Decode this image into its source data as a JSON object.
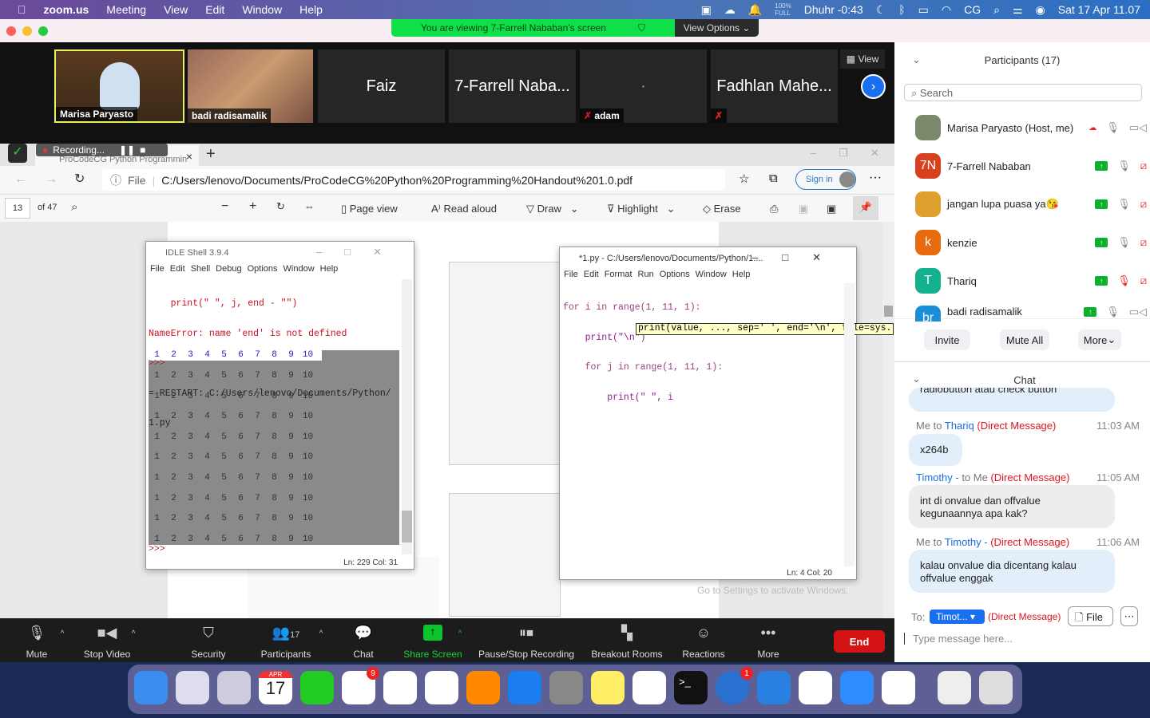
{
  "menubar": {
    "app": "zoom.us",
    "items": [
      "Meeting",
      "View",
      "Edit",
      "Window",
      "Help"
    ],
    "battery_pct": "100%",
    "battery_label": "FULL",
    "prayer": "Dhuhr -0:43",
    "user": "CG",
    "datetime": "Sat 17 Apr  11.07"
  },
  "banner": {
    "text": "You are viewing 7-Farrell Nababan's screen",
    "view_options": "View Options"
  },
  "videos": [
    {
      "name": "Marisa Paryasto"
    },
    {
      "name": "badi radisamalik"
    },
    {
      "name": "Faiz"
    },
    {
      "name": "7-Farrell Naba..."
    },
    {
      "name": "adam",
      "center": "·"
    },
    {
      "name": "Fadhlan Mahe..."
    }
  ],
  "view_label": "View",
  "recording": {
    "label": "Recording..."
  },
  "browser": {
    "tab_title": "ProCodeCG Python Programmin",
    "file_label": "File",
    "url": "C:/Users/lenovo/Documents/ProCodeCG%20Python%20Programming%20Handout%201.0.pdf",
    "sign_in": "Sign in",
    "page": "13",
    "of_pages": "of 47",
    "page_view": "Page view",
    "read_aloud": "Read aloud",
    "draw": "Draw",
    "highlight": "Highlight",
    "erase": "Erase"
  },
  "idle_shell": {
    "title": "IDLE Shell 3.9.4",
    "menu": [
      "File",
      "Edit",
      "Shell",
      "Debug",
      "Options",
      "Window",
      "Help"
    ],
    "lines": [
      "    print(\" \", j, end - \"\")",
      "NameError: name 'end' is not defined",
      ">>>",
      "= RESTART: C:/Users/lenovo/Documents/Python/",
      "1.py"
    ],
    "header": [
      "1",
      "2",
      "3",
      "4",
      "5",
      "6",
      "7",
      "8",
      "9",
      "10"
    ],
    "rows": [
      [
        "1",
        "2",
        "3",
        "4",
        "5",
        "6",
        "7",
        "8",
        "9",
        "10"
      ],
      [
        "1",
        "2",
        "3",
        "4",
        "5",
        "6",
        "7",
        "8",
        "9",
        "10"
      ],
      [
        "1",
        "2",
        "3",
        "4",
        "5",
        "6",
        "7",
        "8",
        "9",
        "10"
      ],
      [
        "1",
        "2",
        "3",
        "4",
        "5",
        "6",
        "7",
        "8",
        "9",
        "10"
      ],
      [
        "1",
        "2",
        "3",
        "4",
        "5",
        "6",
        "7",
        "8",
        "9",
        "10"
      ],
      [
        "1",
        "2",
        "3",
        "4",
        "5",
        "6",
        "7",
        "8",
        "9",
        "10"
      ],
      [
        "1",
        "2",
        "3",
        "4",
        "5",
        "6",
        "7",
        "8",
        "9",
        "10"
      ],
      [
        "1",
        "2",
        "3",
        "4",
        "5",
        "6",
        "7",
        "8",
        "9",
        "10"
      ],
      [
        "1",
        "2",
        "3",
        "4",
        "5",
        "6",
        "7",
        "8",
        "9",
        "10"
      ]
    ],
    "prompt": ">>>",
    "status": "Ln: 229  Col: 31"
  },
  "editor": {
    "title": "*1.py - C:/Users/lenovo/Documents/Python/1....",
    "menu": [
      "File",
      "Edit",
      "Format",
      "Run",
      "Options",
      "Window",
      "Help"
    ],
    "code": [
      "for i in range(1, 11, 1):",
      "    print(\"\\n\")",
      "    for j in range(1, 11, 1):",
      "        print(\" \", i"
    ],
    "calltip": "print(value, ..., sep=' ', end='\\n', file=sys.",
    "status": "Ln: 4  Col: 20"
  },
  "watermark": {
    "line1": "Activate Windows",
    "line2": "Go to Settings to activate Windows."
  },
  "toolbar": {
    "mute": "Mute",
    "stop_video": "Stop Video",
    "security": "Security",
    "participants": "Participants",
    "participants_count": "17",
    "chat": "Chat",
    "share_screen": "Share Screen",
    "recording": "Pause/Stop Recording",
    "breakout": "Breakout Rooms",
    "reactions": "Reactions",
    "more": "More",
    "end": "End"
  },
  "participants": {
    "title": "Participants (17)",
    "search_placeholder": "Search",
    "list": [
      {
        "name": "Marisa Paryasto  (Host, me)",
        "initials": "",
        "color": "#7a8a6a"
      },
      {
        "name": "7-Farrell Nababan",
        "initials": "7N",
        "color": "#d94020"
      },
      {
        "name": "jangan lupa puasa ya😘",
        "initials": "",
        "color": "#e0a030"
      },
      {
        "name": "kenzie",
        "initials": "k",
        "color": "#e86b10"
      },
      {
        "name": "Thariq",
        "initials": "T",
        "color": "#14b090"
      },
      {
        "name": "badi radisamalik",
        "initials": "br",
        "color": "#1a8fd8"
      }
    ],
    "invite": "Invite",
    "mute_all": "Mute All",
    "more": "More"
  },
  "chat": {
    "title": "Chat",
    "partial": "radiobutton atau check button",
    "messages": [
      {
        "from": "Me to ",
        "to": "Thariq",
        "dm": "(Direct Message)",
        "time": "11:03 AM",
        "text": "x264b"
      },
      {
        "from": "Timothy -",
        "to": " to Me ",
        "dm": "(Direct Message)",
        "time": "11:05 AM",
        "text": "int di onvalue dan offvalue kegunaannya apa kak?"
      },
      {
        "from": "Me to ",
        "to": "Timothy - ",
        "dm": "(Direct Message)",
        "time": "11:06 AM",
        "text": "kalau onvalue dia dicentang kalau offvalue enggak"
      }
    ],
    "to_label": "To:",
    "recipient": "Timot...",
    "dm": "(Direct Message)",
    "file": "File",
    "placeholder": "Type message here..."
  },
  "dock": {
    "icons": [
      "finder",
      "launchpad",
      "preview",
      "calendar",
      "messages",
      "reminders",
      "photos",
      "keynote",
      "books",
      "app-store",
      "system-preferences",
      "notes",
      "safari",
      "terminal",
      "tweetbot",
      "signal",
      "chrome",
      "zoom",
      "safari-technology-preview",
      "screenshots-stack",
      "trash"
    ],
    "calendar_month": "APR",
    "calendar_day": "17",
    "reminders_badge": "9",
    "tweetbot_badge": "1"
  }
}
